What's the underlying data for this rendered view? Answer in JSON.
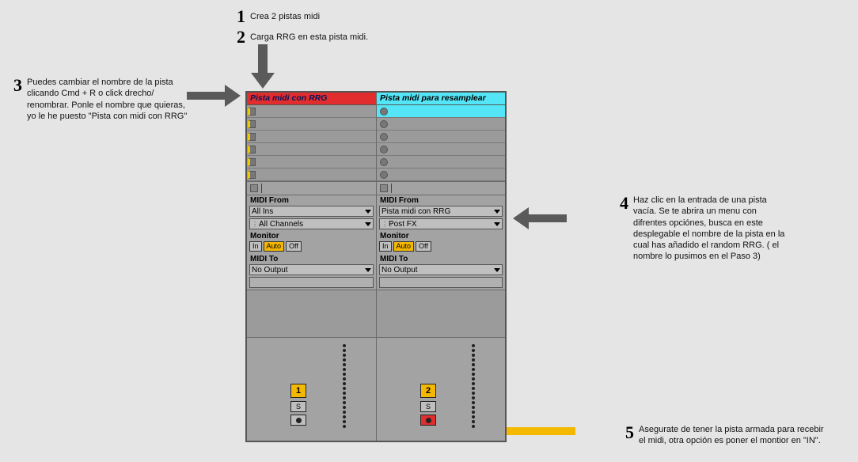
{
  "steps": {
    "s1": {
      "num": "1",
      "text": "Crea 2 pistas midi"
    },
    "s2": {
      "num": "2",
      "text": "Carga RRG en esta pista midi."
    },
    "s3": {
      "num": "3",
      "text": "Puedes cambiar el nombre de la pista clicando Cmd + R o click drecho/ renombrar. Ponle el nombre que quieras, yo le he puesto \"Pista con midi con RRG\""
    },
    "s4": {
      "num": "4",
      "text": "Haz clic en la entrada de una pista vacía. Se te abrira un menu con difrentes opciónes, busca en este desplegable el nombre de la pista en la cual has añadido el random RRG. ( el nombre lo pusimos en el Paso 3)"
    },
    "s5": {
      "num": "5",
      "text": "Asegurate de tener la pista armada para recebir el midi, otra opción es poner el montior en \"IN\"."
    }
  },
  "track1": {
    "title": "Pista midi con RRG",
    "midi_from_label": "MIDI From",
    "midi_from_sel1": "All Ins",
    "midi_from_sel2": "All Channels",
    "monitor_label": "Monitor",
    "mon_in": "In",
    "mon_auto": "Auto",
    "mon_off": "Off",
    "midi_to_label": "MIDI To",
    "midi_to_sel": "No Output",
    "number": "1",
    "solo": "S"
  },
  "track2": {
    "title": "Pista midi para resamplear",
    "midi_from_label": "MIDI From",
    "midi_from_sel1": "Pista midi con RRG",
    "midi_from_sel2": "Post FX",
    "monitor_label": "Monitor",
    "mon_in": "In",
    "mon_auto": "Auto",
    "mon_off": "Off",
    "midi_to_label": "MIDI To",
    "midi_to_sel": "No Output",
    "number": "2",
    "solo": "S"
  }
}
